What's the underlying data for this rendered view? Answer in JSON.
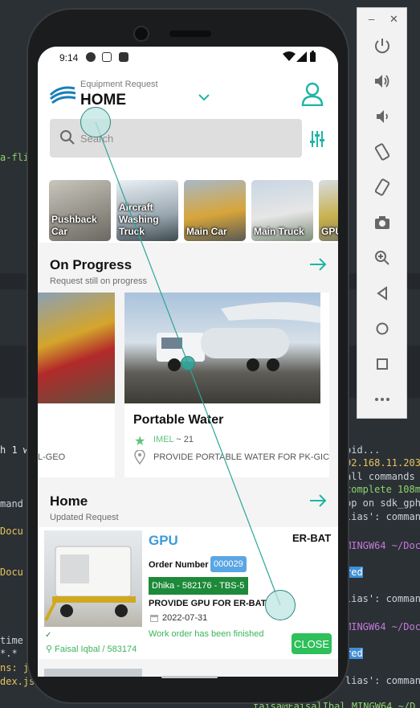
{
  "status_bar": {
    "time": "9:14"
  },
  "header": {
    "subtitle": "Equipment Request",
    "title": "HOME",
    "search_placeholder": "Search"
  },
  "categories": [
    {
      "label": "Pushback Car"
    },
    {
      "label": "Aircraft Washing Truck"
    },
    {
      "label": "Main Car"
    },
    {
      "label": "Main Truck"
    },
    {
      "label": "GPU"
    }
  ],
  "on_progress": {
    "title": "On Progress",
    "subtitle": "Request still on progress",
    "cards": [
      {
        "name": "",
        "desc": "L-GEO"
      },
      {
        "name": "Portable Water",
        "creator": "IMEL",
        "count": "~ 21",
        "desc": "PROVIDE PORTABLE WATER FOR PK-GIC"
      }
    ]
  },
  "home": {
    "title": "Home",
    "subtitle": "Updated Request",
    "card": {
      "equipment": "GPU",
      "code": "ER-BAT",
      "order_label": "Order Number",
      "order_value": "000029",
      "requester": "Dhika - 582176 - TBS-5",
      "title": "PROVIDE GPU FOR ER-BAT",
      "date": "2022-07-31",
      "status": "Work order has been finished",
      "user": "Faisal Iqbal / 583174",
      "close_label": "CLOSE"
    }
  },
  "terminal": {
    "left_lines": [
      "a-fli",
      "h 1 w",
      "mand",
      "Docu",
      "Docu",
      "time",
      "*.*",
      "ns: j",
      "dex.js"
    ],
    "right_lines": [
      "oid...",
      "92.168.11.203",
      "all commands",
      "complete 108m",
      "op on sdk_gph",
      "lias': comman",
      "MINGW64 ~/Doc",
      "red",
      "lias': comman",
      "MINGW64 ~/Doc",
      "red",
      "lias': comman",
      "faisa@FaisalIbal MINGW64 ~/D"
    ]
  },
  "colors": {
    "accent": "#1fb5a5",
    "success": "#2ec05a",
    "dark_green": "#1d8a3a",
    "blue": "#3b9bd9"
  }
}
